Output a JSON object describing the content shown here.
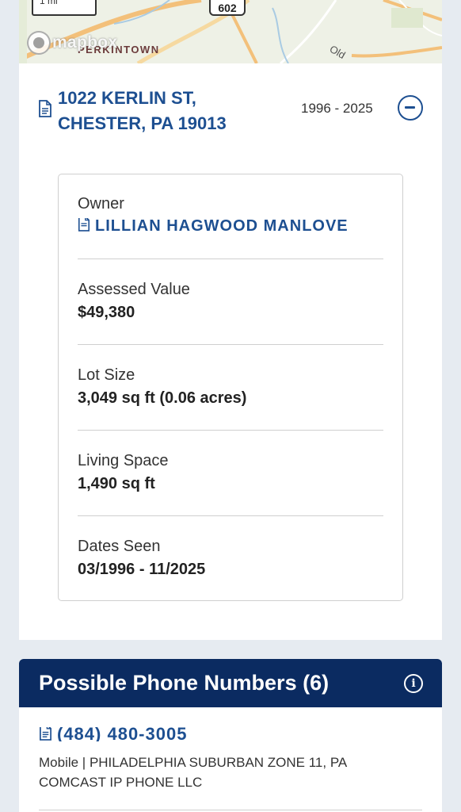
{
  "map": {
    "scale_label": "1 mi",
    "route_number": "602",
    "logo_text": "mapbox",
    "place_label": "PERKINTOWN",
    "road_label": "Old"
  },
  "property": {
    "address_line1": "1022 KERLIN ST,",
    "address_line2": "CHESTER, PA 19013",
    "year_range": "1996 - 2025",
    "details": [
      {
        "label": "Owner",
        "value": "LILLIAN HAGWOOD MANLOVE"
      },
      {
        "label": "Assessed Value",
        "value": "$49,380"
      },
      {
        "label": "Lot Size",
        "value": "3,049 sq ft (0.06 acres)"
      },
      {
        "label": "Living Space",
        "value": "1,490 sq ft"
      },
      {
        "label": "Dates Seen",
        "value": "03/1996 - 11/2025"
      }
    ]
  },
  "phones": {
    "title": "Possible Phone Numbers (6)",
    "info_icon": "i",
    "items": [
      {
        "number": "(484) 480-3005",
        "meta_line1": "Mobile | PHILADELPHIA SUBURBAN ZONE 11, PA",
        "meta_line2": "COMCAST IP PHONE LLC"
      }
    ]
  },
  "colors": {
    "link_blue": "#1d4f91",
    "header_navy": "#0b2b61",
    "page_bg": "#e6ebf1"
  }
}
